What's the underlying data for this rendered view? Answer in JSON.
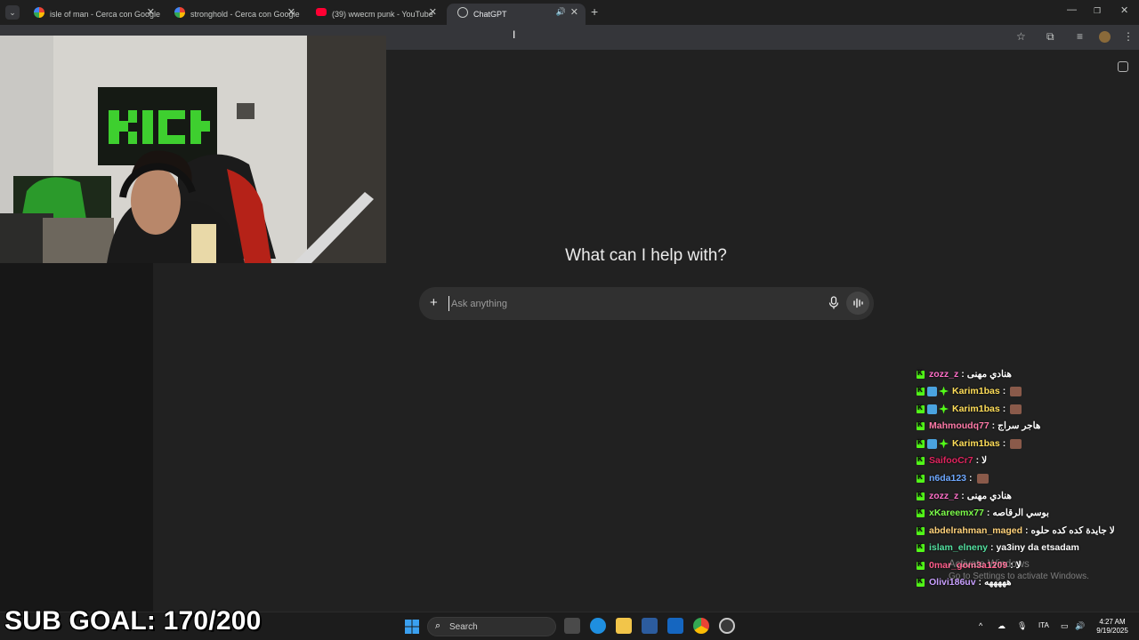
{
  "browser": {
    "tabs": [
      {
        "title": "isle of man - Cerca con Google",
        "favicon": "google-icon",
        "active": false
      },
      {
        "title": "stronghold - Cerca con Google",
        "favicon": "google-icon",
        "active": false
      },
      {
        "title": "(39) wwecm punk - YouTube",
        "favicon": "youtube-icon",
        "active": false
      },
      {
        "title": "ChatGPT",
        "favicon": "chatgpt-icon",
        "active": true
      }
    ],
    "close_glyph": "✕",
    "new_tab_glyph": "+"
  },
  "page": {
    "heading": "What can I help with?",
    "composer": {
      "placeholder": "Ask anything",
      "plus_glyph": "+"
    }
  },
  "chat": [
    {
      "user": "zozz_z",
      "color": "#ff6fc8",
      "text": "هنادي مهنى",
      "badges": []
    },
    {
      "user": "Karim1bas",
      "color": "#ffde59",
      "text": "",
      "emote": true,
      "badges": [
        "blue",
        "green"
      ]
    },
    {
      "user": "Karim1bas",
      "color": "#ffde59",
      "text": "",
      "emote": true,
      "badges": [
        "blue",
        "green"
      ]
    },
    {
      "user": "Mahmoudq77",
      "color": "#ff7aa8",
      "text": "هاجر سراج",
      "badges": []
    },
    {
      "user": "Karim1bas",
      "color": "#ffde59",
      "text": "",
      "emote": true,
      "badges": [
        "blue",
        "green"
      ]
    },
    {
      "user": "SaifooCr7",
      "color": "#e0245e",
      "text": "لا",
      "badges": []
    },
    {
      "user": "n6da123",
      "color": "#6ea8ff",
      "text": "",
      "emote": true,
      "badges": []
    },
    {
      "user": "zozz_z",
      "color": "#ff6fc8",
      "text": "هنادي مهنى",
      "badges": []
    },
    {
      "user": "xKareemx77",
      "color": "#7cfc4a",
      "text": "بوسي الرقاصه",
      "badges": []
    },
    {
      "user": "abdelrahman_maged",
      "color": "#ffd27a",
      "text": "لا جايدة كده كده حلوه",
      "badges": []
    },
    {
      "user": "islam_elneny",
      "color": "#53e0a0",
      "text": "ya3iny da etsadam",
      "badges": []
    },
    {
      "user": "0mar_gom3a1209",
      "color": "#ff5c8a",
      "text": "لا",
      "badges": []
    },
    {
      "user": "Olivi186uv",
      "color": "#c9a0ff",
      "text": "هههههه",
      "badges": []
    }
  ],
  "watermark": {
    "line1": "Activate Windows",
    "line2": "Go to Settings to activate Windows."
  },
  "overlay": {
    "sub_goal": "SUB GOAL: 170/200"
  },
  "taskbar": {
    "search_label": "Search",
    "language": "ITA",
    "time": "4:27 AM",
    "date": "9/19/2025"
  }
}
